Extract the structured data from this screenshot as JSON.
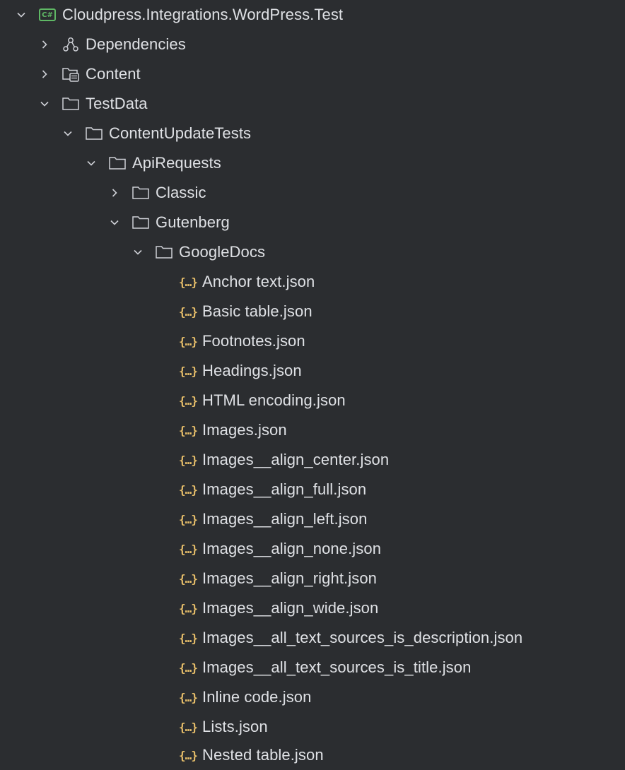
{
  "colors": {
    "background": "#2b2d30",
    "text": "#dfe1e5",
    "icon": "#ced0d6",
    "json_icon": "#e8bf6a",
    "csharp_badge": "#5fb865"
  },
  "project": {
    "name": "Cloudpress.Integrations.WordPress.Test",
    "icon": "csharp-project-icon",
    "badge": "C#",
    "expanded": true
  },
  "nodes": {
    "dependencies": {
      "label": "Dependencies",
      "icon": "dependencies-icon",
      "expanded": false
    },
    "content": {
      "label": "Content",
      "icon": "content-folder-icon",
      "expanded": false
    },
    "testdata": {
      "label": "TestData",
      "icon": "folder-icon",
      "expanded": true
    },
    "contentupdatetests": {
      "label": "ContentUpdateTests",
      "icon": "folder-icon",
      "expanded": true
    },
    "apirequests": {
      "label": "ApiRequests",
      "icon": "folder-icon",
      "expanded": true
    },
    "classic": {
      "label": "Classic",
      "icon": "folder-icon",
      "expanded": false
    },
    "gutenberg": {
      "label": "Gutenberg",
      "icon": "folder-icon",
      "expanded": true
    },
    "googledocs": {
      "label": "GoogleDocs",
      "icon": "folder-icon",
      "expanded": true
    }
  },
  "json_icon_glyph": "{…}",
  "files": [
    "Anchor text.json",
    "Basic table.json",
    "Footnotes.json",
    "Headings.json",
    "HTML encoding.json",
    "Images.json",
    "Images__align_center.json",
    "Images__align_full.json",
    "Images__align_left.json",
    "Images__align_none.json",
    "Images__align_right.json",
    "Images__align_wide.json",
    "Images__all_text_sources_is_description.json",
    "Images__all_text_sources_is_title.json",
    "Inline code.json",
    "Lists.json",
    "Nested table.json"
  ]
}
